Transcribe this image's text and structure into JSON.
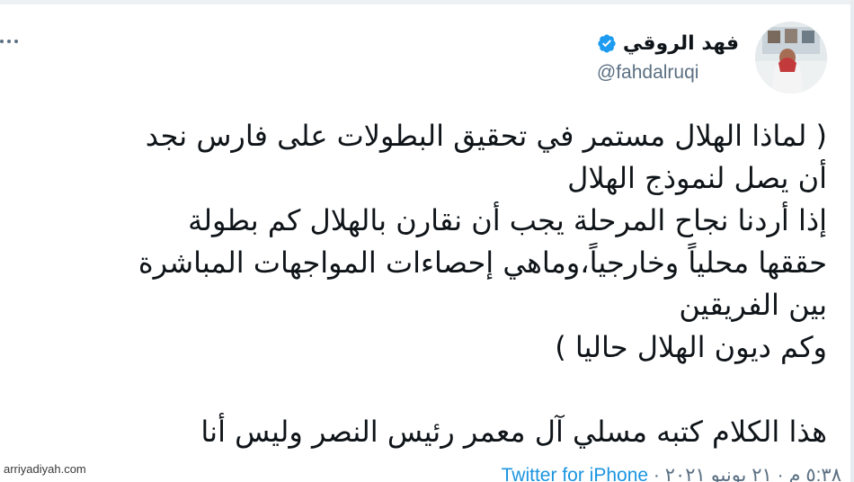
{
  "tweet": {
    "author": {
      "display_name": "فهد الروقي",
      "handle": "@fahdalruqi",
      "verified": true,
      "avatar_icon": "avatar-photo"
    },
    "more_icon": "more-options-icon",
    "lines": [
      "( لماذا الهلال مستمر في تحقيق البطولات على فارس نجد",
      "أن يصل لنموذج  الهلال",
      "إذا أردنا نجاح المرحلة  يجب أن نقارن بالهلال كم بطولة",
      "حققها محلياً وخارجياً،وماهي إحصاءات المواجهات المباشرة",
      "بين الفريقين",
      "وكم ديون الهلال حاليا )",
      "",
      "هذا الكلام كتبه مسلي آل معمر رئيس النصر وليس أنا"
    ],
    "meta": {
      "time_date": "٥:٣٨ م · ٢١ يونيو ٢٠٢١ · ",
      "source": "Twitter for iPhone"
    }
  },
  "watermark": "arriyadiyah.com",
  "colors": {
    "text": "#0f1419",
    "secondary": "#5b7083",
    "verified_badge": "#1d9bf0",
    "link": "#1b95e0"
  }
}
